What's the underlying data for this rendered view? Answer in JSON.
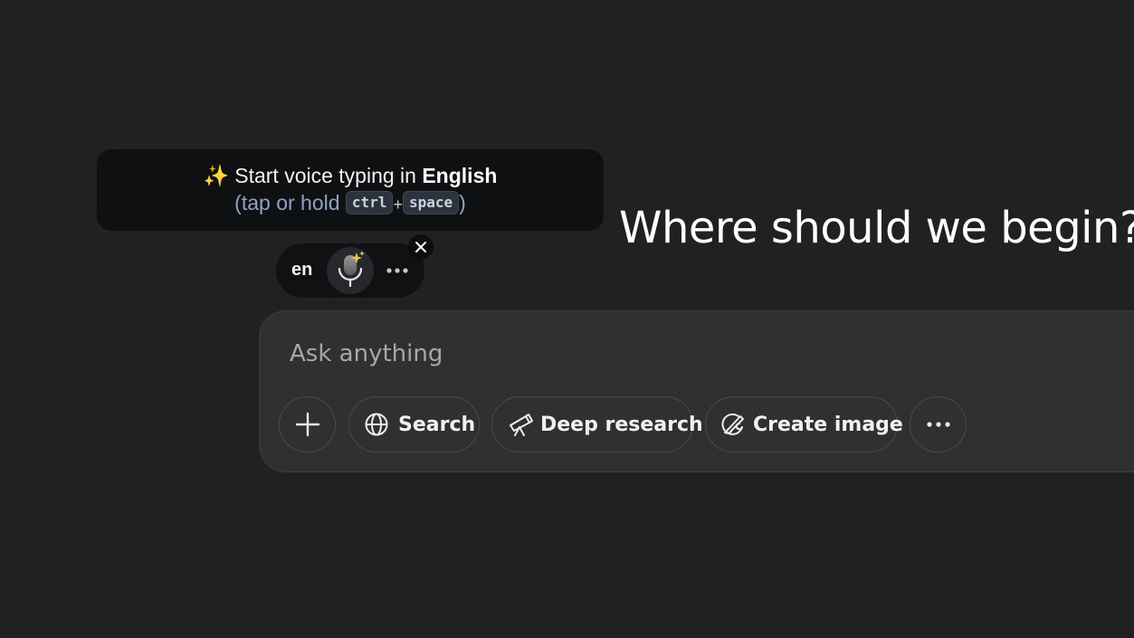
{
  "voice_tip": {
    "sparkle": "✨",
    "line1_prefix": "Start voice typing in ",
    "language_name": "English",
    "line2_open": "(tap or hold ",
    "key1": "ctrl",
    "plus": "+",
    "key2": "space",
    "line2_close": ")"
  },
  "voice_pill": {
    "lang_code": "en"
  },
  "heading": "Where should we begin?",
  "composer": {
    "placeholder": "Ask anything",
    "tools": [
      {
        "label": "Search",
        "icon": "globe-icon"
      },
      {
        "label": "Deep research",
        "icon": "telescope-icon"
      },
      {
        "label": "Create image",
        "icon": "paint-brush-icon"
      }
    ]
  },
  "colors": {
    "background": "#212121",
    "composer": "#303030",
    "tooltip": "#0f1012",
    "accent_sparkle": "#f5c542"
  }
}
